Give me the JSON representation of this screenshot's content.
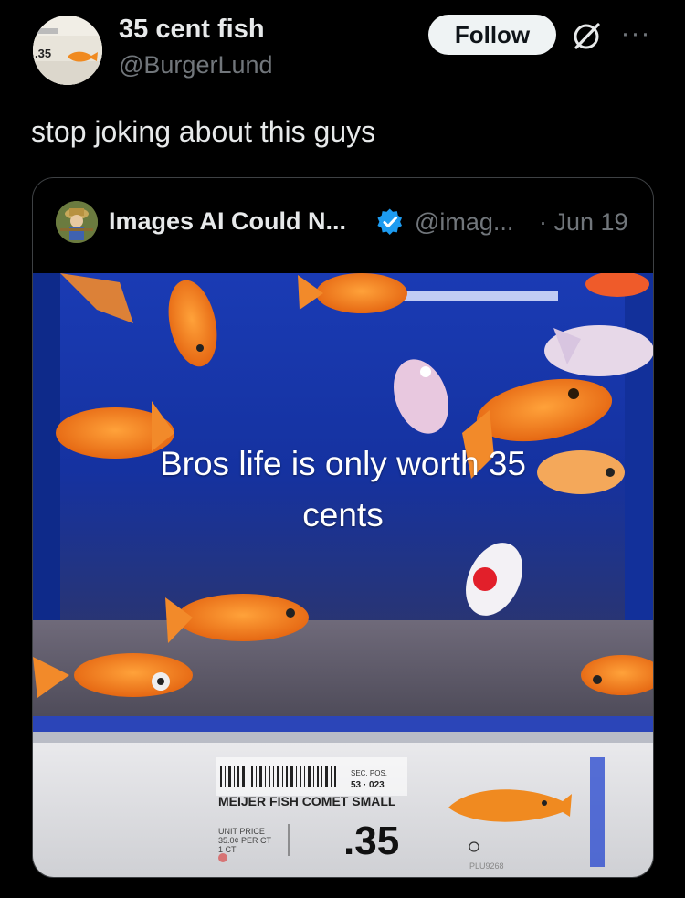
{
  "post": {
    "author_name": "35 cent fish",
    "author_handle": "@BurgerLund",
    "follow_label": "Follow",
    "more_label": "···",
    "text": "stop joking about this guys",
    "avatar_price": ".35"
  },
  "quoted": {
    "author_name": "Images AI Could N...",
    "author_handle": "@imag...",
    "date": "· Jun 19",
    "caption_line1": "Bros life is only worth 35",
    "caption_line2": "cents",
    "shelf_label": {
      "barcode_num": "53 · 023",
      "sec_pos": "SEC. POS.",
      "product": "MEIJER FISH COMET SMALL",
      "unit_price_1": "UNIT PRICE",
      "unit_price_2": "35.0¢ PER CT",
      "unit_price_3": "1 CT",
      "price": ".35",
      "plu": "PLU9268"
    }
  },
  "colors": {
    "background": "#000000",
    "text": "#e7e9ea",
    "muted": "#71767b",
    "verified": "#1d9bf0",
    "follow_bg": "#eff3f4",
    "tank_blue": "#1736a8",
    "goldfish": "#f07a1e"
  }
}
